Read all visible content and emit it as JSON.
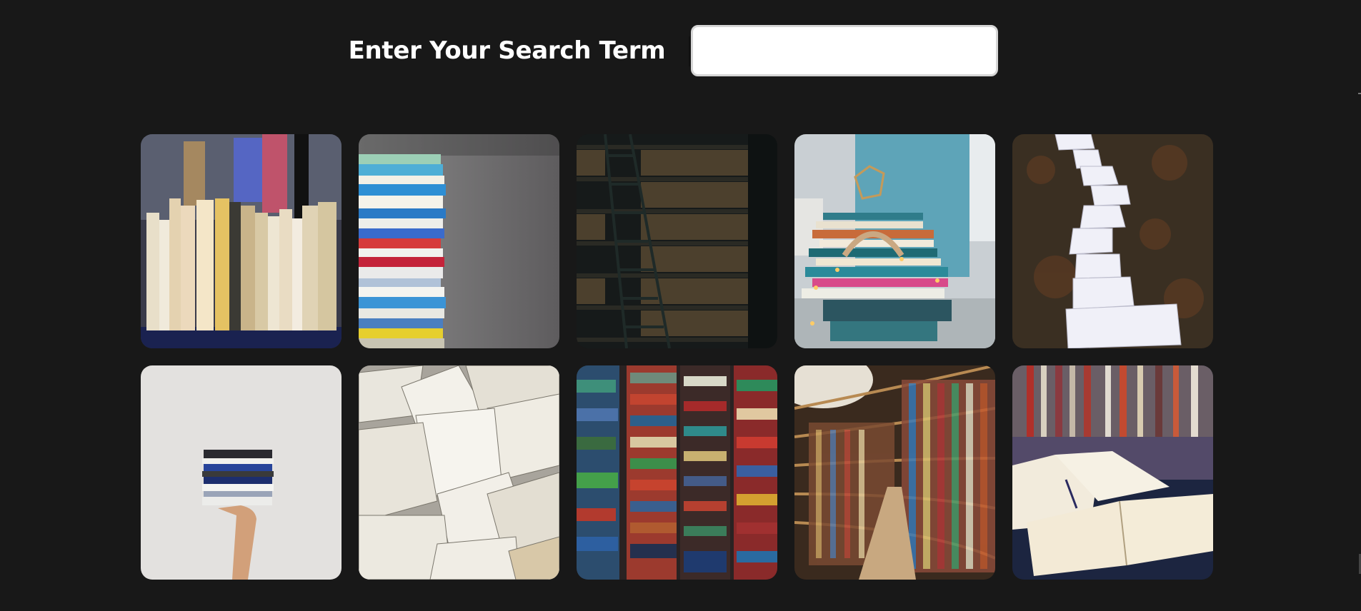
{
  "search": {
    "label": "Enter Your Search Term",
    "value": "",
    "placeholder": ""
  },
  "gallery": {
    "images": [
      {
        "subject": "row of book spines on shelf"
      },
      {
        "subject": "stack of colorful books against grey background"
      },
      {
        "subject": "dark library shelves with ladder"
      },
      {
        "subject": "pile of books with lamp and fairy lights by window"
      },
      {
        "subject": "path of open book pages on autumn leaves"
      },
      {
        "subject": "hand holding small stack of books"
      },
      {
        "subject": "scattered open books"
      },
      {
        "subject": "wall of stacked colorful hardcover books"
      },
      {
        "subject": "curved library bookshelves"
      },
      {
        "subject": "open books on table in library"
      }
    ]
  },
  "colors": {
    "background": "#181818",
    "label": "#ffffff",
    "input_border": "#d6d6d6"
  }
}
